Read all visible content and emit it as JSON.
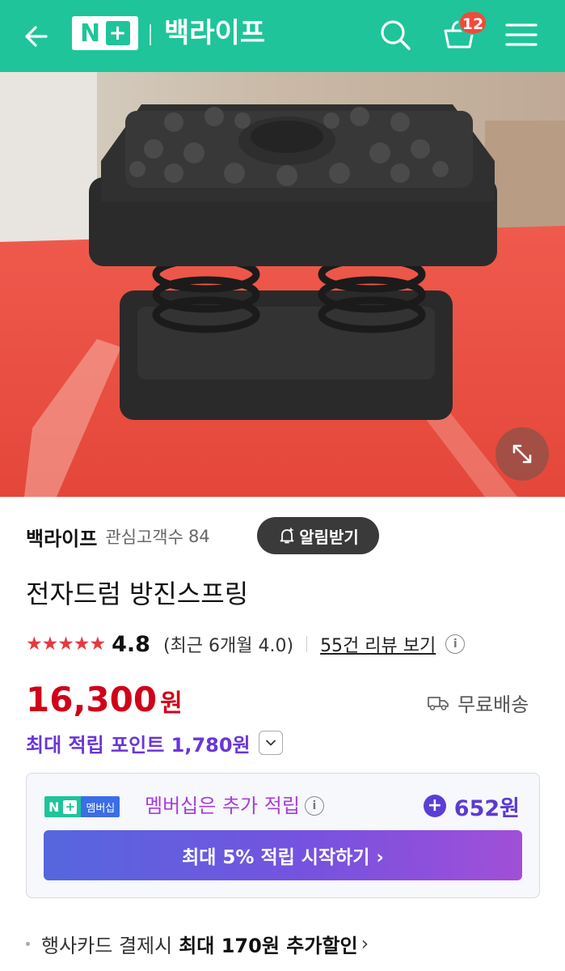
{
  "header": {
    "logo_text": "N+",
    "store_name": "백라이프",
    "cart_count": "12",
    "icons": [
      "back-arrow-icon",
      "search-icon",
      "cart-icon",
      "menu-icon"
    ],
    "background_color": "#1fc49a"
  },
  "product_image": {
    "icon": "expand-icon"
  },
  "seller": {
    "name": "백라이프",
    "follower_label": "관심고객수",
    "follower_count": "84",
    "alarm_button": "알림받기"
  },
  "product": {
    "title": "전자드럼 방진스프링",
    "stars": "★★★★★",
    "rating": "4.8",
    "recent_rating": "(최근 6개월 4.0)",
    "review_link": "55건 리뷰 보기",
    "price": "16,300",
    "price_unit": "원",
    "shipping": "무료배송",
    "max_points": "최대 적립 포인트 1,780원"
  },
  "membership": {
    "badge_label": "멤버십",
    "text": "멤버십은 추가 적립",
    "extra_points": "652원",
    "cta": "최대 5% 적립 시작하기 ›"
  },
  "card_discount": {
    "prefix": "행사카드 결제시",
    "highlight": "최대 170원 추가할인",
    "chevron": "›"
  },
  "colors": {
    "price": "#d0021b",
    "points": "#6a36d8",
    "membership_text": "#a43fd9"
  }
}
